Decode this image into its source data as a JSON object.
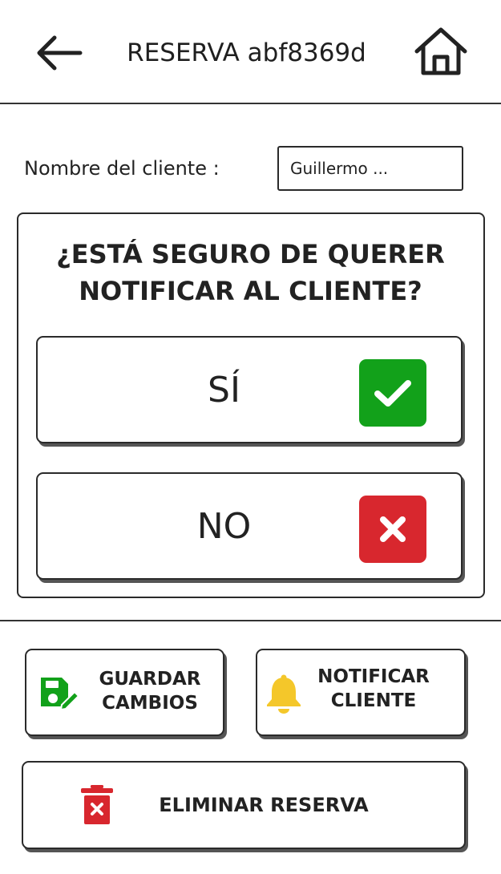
{
  "header": {
    "title": "RESERVA abf8369d",
    "back_icon": "arrow-left-icon",
    "home_icon": "home-icon"
  },
  "client": {
    "label": "Nombre del cliente :",
    "value": "Guillermo ..."
  },
  "dialog": {
    "question": "¿ESTÁ SEGURO DE QUERER NOTIFICAR AL CLIENTE?",
    "yes": {
      "label": "SÍ",
      "icon": "check-icon",
      "color": "#12a11a"
    },
    "no": {
      "label": "NO",
      "icon": "close-icon",
      "color": "#d8272e"
    }
  },
  "actions": {
    "save": {
      "line1": "GUARDAR",
      "line2": "CAMBIOS",
      "icon": "save-edit-icon",
      "color": "#12a11a"
    },
    "notify": {
      "line1": "NOTIFICAR",
      "line2": "CLIENTE",
      "icon": "bell-icon",
      "color": "#f4c72a"
    },
    "delete": {
      "label": "ELIMINAR RESERVA",
      "icon": "trash-icon",
      "color": "#d8272e"
    }
  }
}
